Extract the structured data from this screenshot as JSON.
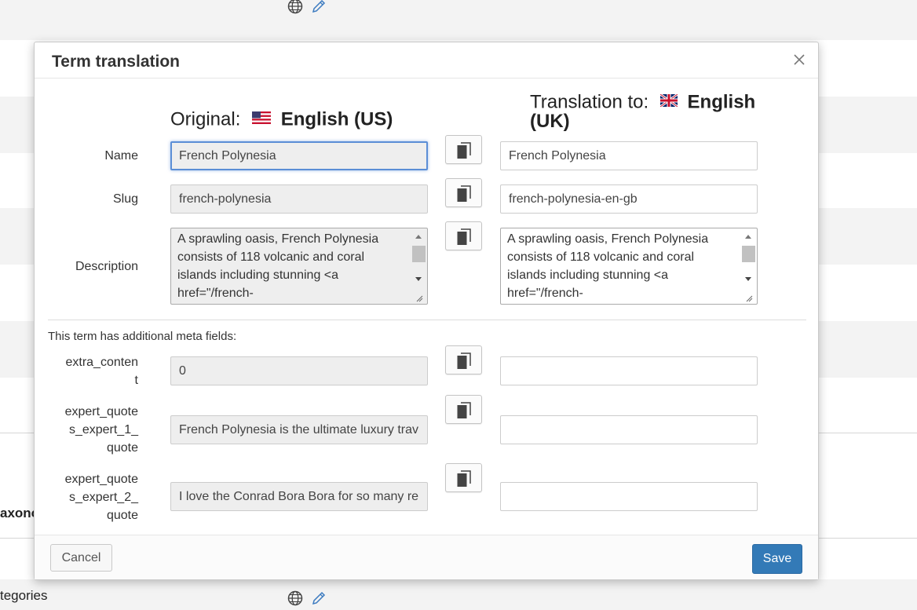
{
  "background": {
    "row_label_taxonomy": "axono",
    "row_label_categories": "tegories"
  },
  "modal": {
    "title": "Term translation",
    "original_prefix": "Original:",
    "original_language": "English (US)",
    "translation_prefix": "Translation to:",
    "translation_language_line1": "English",
    "translation_language_line2": "(UK)",
    "meta_note": "This term has additional meta fields:",
    "fields": {
      "name": {
        "label": "Name",
        "original": "French Polynesia",
        "translation": "French Polynesia"
      },
      "slug": {
        "label": "Slug",
        "original": "french-polynesia",
        "translation": "french-polynesia-en-gb"
      },
      "description": {
        "label": "Description",
        "original_lines": [
          "A sprawling oasis, French Polynesia",
          "consists of 118 volcanic and coral",
          "islands including stunning <a",
          "href=\"/french-"
        ],
        "translation_lines": [
          "A sprawling oasis, French Polynesia",
          "consists of 118 volcanic and coral",
          "islands including stunning <a",
          "href=\"/french-"
        ]
      },
      "extra_content": {
        "label_line1": "extra_conten",
        "label_line2": "t",
        "original": "0",
        "translation": ""
      },
      "expert_quote_1": {
        "label_line1": "expert_quote",
        "label_line2": "s_expert_1_",
        "label_line3": "quote",
        "original": "French Polynesia is the ultimate luxury trav",
        "translation": ""
      },
      "expert_quote_2": {
        "label_line1": "expert_quote",
        "label_line2": "s_expert_2_",
        "label_line3": "quote",
        "original": "I love the Conrad Bora Bora for so many re",
        "translation": ""
      }
    },
    "cancel_label": "Cancel",
    "save_label": "Save"
  },
  "icons": {
    "close": "close-icon",
    "copy": "copy-icon",
    "globe": "globe-icon",
    "pencil": "pencil-icon",
    "flag_us": "us-flag-icon",
    "flag_uk": "uk-flag-icon"
  },
  "colors": {
    "save_button": "#337ab7",
    "focus_border": "#5b8ed6",
    "readonly_field": "#eeeeee"
  }
}
